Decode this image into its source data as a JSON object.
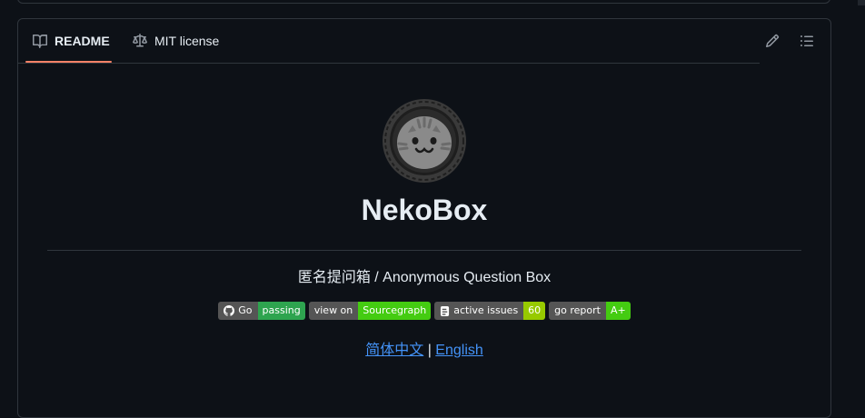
{
  "tabs": {
    "readme": "README",
    "license": "MIT license"
  },
  "readme": {
    "title": "NekoBox",
    "subtitle": "匿名提问箱 / Anonymous Question Box",
    "badges": [
      {
        "left": "Go",
        "right": "passing",
        "right_color": "#2ea44f",
        "icon": "github-icon"
      },
      {
        "left": "view on",
        "right": "Sourcegraph",
        "right_color": "#44cc11"
      },
      {
        "left": "active issues",
        "right": "60",
        "right_color": "#97ca00",
        "icon": "deepsource-icon"
      },
      {
        "left": "go report",
        "right": "A+",
        "right_color": "#44cc11"
      }
    ],
    "lang_zh": "简体中文",
    "lang_sep": "|",
    "lang_en": "English"
  },
  "colors": {
    "background": "#0d1117",
    "border": "#30363d",
    "accent_tab": "#f78166",
    "link": "#4493f8"
  }
}
